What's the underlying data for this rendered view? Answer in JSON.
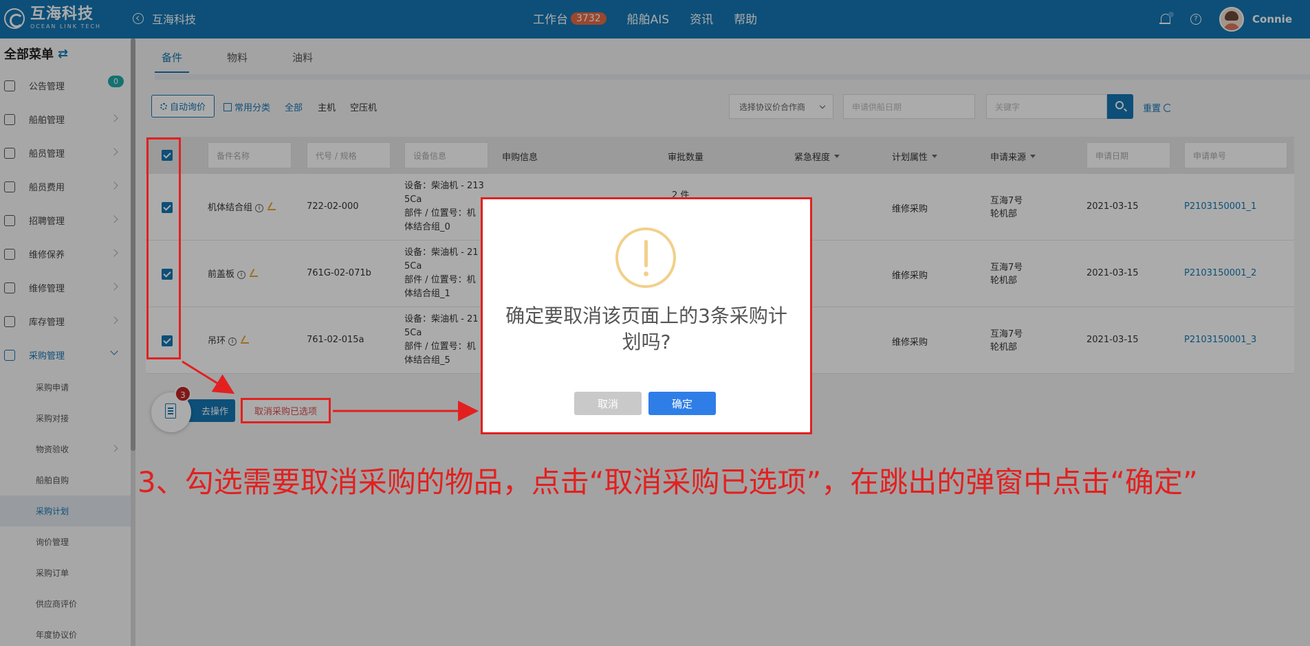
{
  "header": {
    "logo_cn": "互海科技",
    "logo_en": "OCEAN LINK TECH",
    "company": "互海科技",
    "nav": [
      {
        "label": "工作台",
        "badge": "3732"
      },
      {
        "label": "船舶AIS"
      },
      {
        "label": "资讯"
      },
      {
        "label": "帮助"
      }
    ],
    "username": "Connie"
  },
  "sidebar": {
    "title": "全部菜单",
    "items": [
      {
        "label": "公告管理",
        "badge": "0"
      },
      {
        "label": "船舶管理"
      },
      {
        "label": "船员管理"
      },
      {
        "label": "船员费用"
      },
      {
        "label": "招聘管理"
      },
      {
        "label": "维修保养"
      },
      {
        "label": "维修管理"
      },
      {
        "label": "库存管理"
      },
      {
        "label": "采购管理"
      }
    ],
    "sub_items": [
      "采购申请",
      "采购对接",
      "物资验收",
      "船舶自购",
      "采购计划",
      "询价管理",
      "采购订单",
      "供应商评价",
      "年度协议价"
    ]
  },
  "tabs": [
    "备件",
    "物料",
    "油料"
  ],
  "toolbar": {
    "auto_inquiry": "自动询价",
    "common_category": "常用分类",
    "all": "全部",
    "main_engine": "主机",
    "air_compressor": "空压机",
    "supplier_placeholder": "选择协议价合作商",
    "date_placeholder": "申请供船日期",
    "keyword_placeholder": "关键字",
    "reset": "重置"
  },
  "table": {
    "headers": {
      "part_name": "备件名称",
      "code_spec": "代号 / 规格",
      "device_info": "设备信息",
      "purchase_info": "申购信息",
      "approved_qty": "审批数量",
      "urgency": "紧急程度",
      "plan_attr": "计划属性",
      "source": "申请来源",
      "apply_date": "申请日期",
      "apply_no": "申请单号"
    },
    "rows": [
      {
        "name": "机体结合组",
        "code": "722-02-000",
        "dev1": "设备：柴油机 - 213",
        "dev2": "5Ca",
        "dev3": "部件 / 位置号：机",
        "dev4": "体结合组_0",
        "qty": "2   件",
        "plan": "维修采购",
        "src1": "互海7号",
        "src2": "轮机部",
        "date": "2021-03-15",
        "no": "P2103150001_1"
      },
      {
        "name": "前盖板",
        "code": "761G-02-071b",
        "dev1": "设备：柴油机 - 21",
        "dev2": "5Ca",
        "dev3": "部件 / 位置号：机",
        "dev4": "体结合组_1",
        "qty": "",
        "plan": "维修采购",
        "src1": "互海7号",
        "src2": "轮机部",
        "date": "2021-03-15",
        "no": "P2103150001_2"
      },
      {
        "name": "吊环",
        "code": "761-02-015a",
        "dev1": "设备：柴油机 - 21",
        "dev2": "5Ca",
        "dev3": "部件 / 位置号：机",
        "dev4": "体结合组_5",
        "qty": "",
        "plan": "维修采购",
        "src1": "互海7号",
        "src2": "轮机部",
        "date": "2021-03-15",
        "no": "P2103150001_3"
      }
    ]
  },
  "actions": {
    "selected_count": "3",
    "go_operate": "去操作",
    "cancel_selected": "取消采购已选项"
  },
  "dialog": {
    "message": "确定要取消该页面上的3条采购计划吗?",
    "cancel": "取消",
    "confirm": "确定"
  },
  "annotation": {
    "instruction": "3、勾选需要取消采购的物品，点击“取消采购已选项”，在跳出的弹窗中点击“确定”"
  }
}
